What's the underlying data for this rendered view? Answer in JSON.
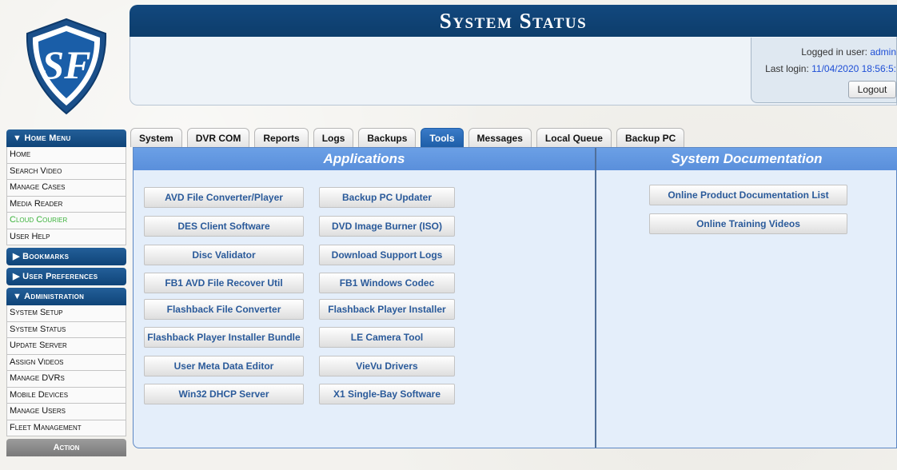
{
  "header": {
    "title": "System Status",
    "logged_in_label": "Logged in user:",
    "logged_in_user": "admin",
    "last_login_label": "Last login:",
    "last_login_value": "11/04/2020 18:56:5:",
    "logout_label": "Logout"
  },
  "sidebar": {
    "home_menu_title": "▼ Home Menu",
    "home_items": [
      "Home",
      "Search Video",
      "Manage Cases",
      "Media Reader",
      "Cloud Courier",
      "User Help"
    ],
    "bookmarks_title": "▶ Bookmarks",
    "user_prefs_title": "▶ User Preferences",
    "admin_title": "▼ Administration",
    "admin_items": [
      "System Setup",
      "System Status",
      "Update Server",
      "Assign Videos",
      "Manage DVRs",
      "Mobile Devices",
      "Manage Users",
      "Fleet Management"
    ],
    "action_title": "Action"
  },
  "tabs": [
    "System",
    "DVR COM",
    "Reports",
    "Logs",
    "Backups",
    "Tools",
    "Messages",
    "Local Queue",
    "Backup PC"
  ],
  "active_tab": "Tools",
  "applications": {
    "title": "Applications",
    "left": [
      "AVD File Converter/Player",
      "DES Client Software",
      "Disc Validator",
      "FB1 AVD File Recover Util",
      "Flashback File Converter",
      "Flashback Player Installer Bundle",
      "User Meta Data Editor",
      "Win32 DHCP Server"
    ],
    "right": [
      "Backup PC Updater",
      "DVD Image Burner (ISO)",
      "Download Support Logs",
      "FB1 Windows Codec",
      "Flashback Player Installer",
      "LE Camera Tool",
      "VieVu Drivers",
      "X1 Single-Bay Software"
    ]
  },
  "documentation": {
    "title": "System Documentation",
    "buttons": [
      "Online Product Documentation List",
      "Online Training Videos"
    ]
  },
  "colors": {
    "header_blue": "#12487e",
    "column_header": "#6ba0e6",
    "link_blue": "#2a5a9a",
    "active_green": "#3db33d"
  }
}
